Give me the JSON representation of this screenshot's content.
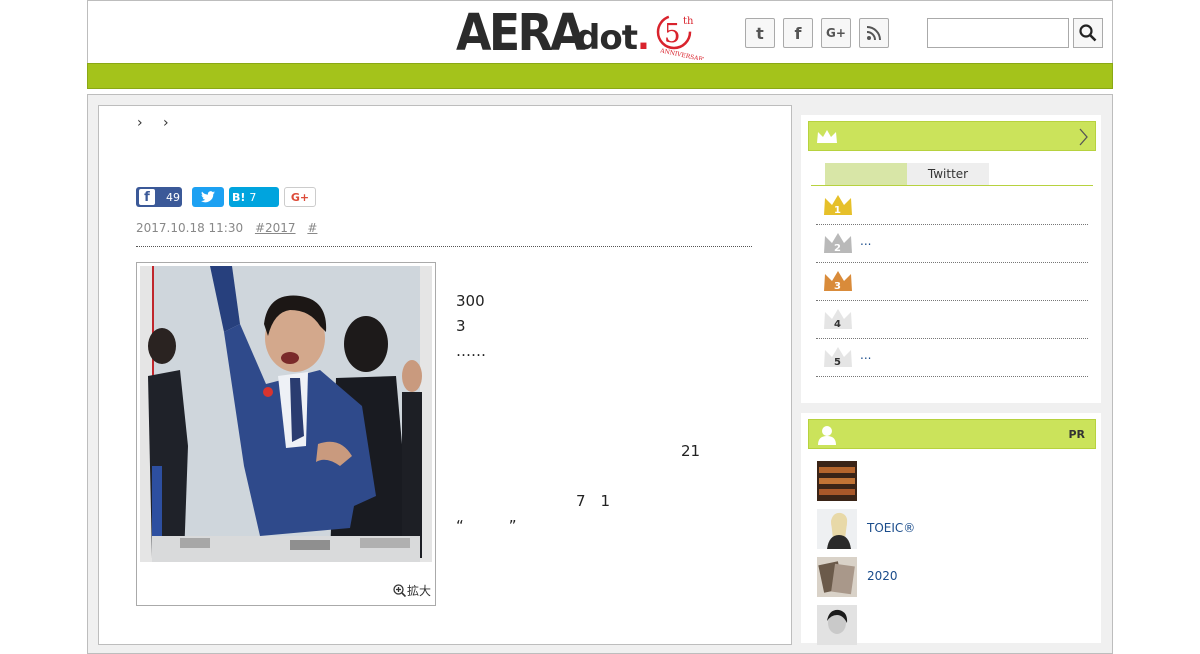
{
  "header": {
    "logo_main": "AERA",
    "logo_dot": "dot",
    "logo_badge_number": "5",
    "logo_badge_suffix": "th",
    "logo_badge_text": "ANNIVERSARY",
    "social_icons": [
      "twitter-icon",
      "facebook-icon",
      "google-plus-icon",
      "rss-icon"
    ],
    "social_labels": {
      "twitter": "t",
      "facebook": "f",
      "gplus": "G+"
    },
    "search": {
      "value": "",
      "placeholder": ""
    }
  },
  "article": {
    "breadcrumb": "› ›",
    "share": {
      "facebook_count": "49",
      "hatena_label": "B!",
      "hatena_count": "7",
      "gplus_label": "G+"
    },
    "date": "2017.10.18 11:30",
    "tags": [
      "#2017",
      "#"
    ],
    "zoom_label": "拡大",
    "paragraphs": [
      "　　　　　　　　　　　　　　　　　　　　　　　　　　　　　　300　　　　　　　　　　　　　　　　　　3　　　　　　　　　　　　　　　　　　　　　　　　　　　　……　　　　　　　　　　　　　",
      "　　　　　　　　　　　　　　　　　　　　",
      "　　　　　　　　　　　　　　　21　　　　　　　　　　　　　　　　　　　　　　　　　　　　　　　",
      "　　　　　　　　7　1　　　　　　　　　　　　　　　　　　　　　　　“　　　”　　　　　　　　　　　　　　　　　　　　　　　　　　　　　　　　　　　　　　　　　",
      "　　　　　　　　　　　　　　　　　　　　　　　　　　　　　"
    ]
  },
  "sidebar": {
    "ranking": {
      "tabs": [
        "",
        "Twitter"
      ],
      "items": [
        {
          "rank": "1",
          "title": "",
          "color": "#e6c02a"
        },
        {
          "rank": "2",
          "title": "...",
          "color": "#b9b9b9"
        },
        {
          "rank": "3",
          "title": "",
          "color": "#d98b3a"
        },
        {
          "rank": "4",
          "title": "",
          "color": "#e5e5e5"
        },
        {
          "rank": "5",
          "title": "...",
          "color": "#e5e5e5"
        }
      ]
    },
    "pr": {
      "label": "PR",
      "items": [
        {
          "title": ""
        },
        {
          "title": "TOEIC®"
        },
        {
          "title": "2020"
        },
        {
          "title": ""
        }
      ]
    }
  },
  "colors": {
    "accent_green": "#a4c31b",
    "sidebar_head_green": "#cbe35b",
    "link_blue": "#1a4c8b",
    "facebook_blue": "#3b5998",
    "twitter_blue": "#1da1f2",
    "hatena_blue": "#00a4de"
  }
}
